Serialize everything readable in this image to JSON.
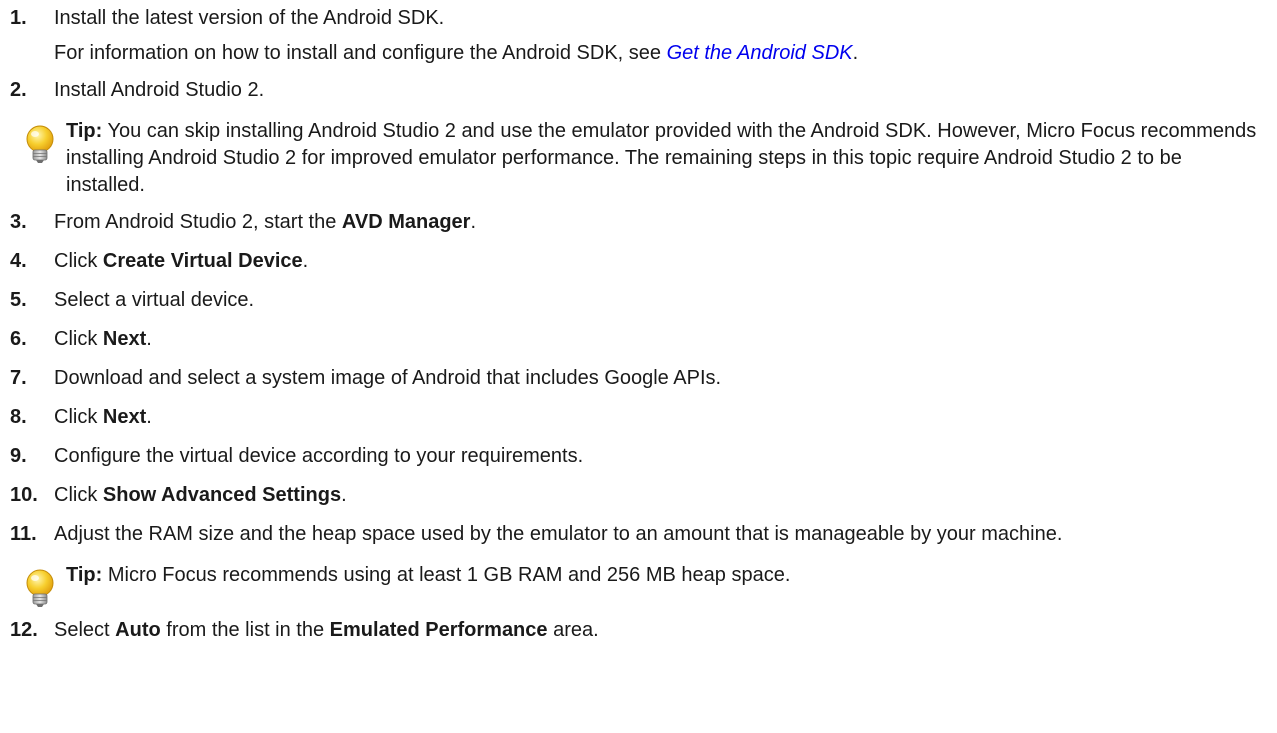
{
  "steps": [
    {
      "num": "1.",
      "pre": "Install the latest version of the Android SDK.",
      "extra_pre": "For information on how to install and configure the Android SDK, see ",
      "link": "Get the Android SDK",
      "extra_post": "."
    },
    {
      "num": "2.",
      "text": "Install Android Studio 2."
    },
    {
      "tip_label": "Tip:",
      "tip_text": " You can skip installing Android Studio 2 and use the emulator provided with the Android SDK. However, Micro Focus recommends installing Android Studio 2 for improved emulator performance. The remaining steps in this topic require Android Studio 2 to be installed.",
      "icon": "lightbulb-icon"
    },
    {
      "num": "3.",
      "pre": "From Android Studio 2, start the ",
      "bold": "AVD Manager",
      "post": "."
    },
    {
      "num": "4.",
      "pre": "Click ",
      "bold": "Create Virtual Device",
      "post": "."
    },
    {
      "num": "5.",
      "text": "Select a virtual device."
    },
    {
      "num": "6.",
      "pre": "Click ",
      "bold": "Next",
      "post": "."
    },
    {
      "num": "7.",
      "text": "Download and select a system image of Android that includes Google APIs."
    },
    {
      "num": "8.",
      "pre": "Click ",
      "bold": "Next",
      "post": "."
    },
    {
      "num": "9.",
      "text": "Configure the virtual device according to your requirements."
    },
    {
      "num": "10.",
      "pre": "Click ",
      "bold": "Show Advanced Settings",
      "post": "."
    },
    {
      "num": "11.",
      "text": "Adjust the RAM size and the heap space used by the emulator to an amount that is manageable by your machine."
    },
    {
      "tip_label": "Tip:",
      "tip_text": " Micro Focus recommends using at least 1 GB RAM and 256 MB heap space.",
      "icon": "lightbulb-icon"
    },
    {
      "num": "12.",
      "pre": "Select ",
      "bold": "Auto",
      "mid": " from the list in the ",
      "bold2": "Emulated Performance",
      "post": " area."
    }
  ]
}
